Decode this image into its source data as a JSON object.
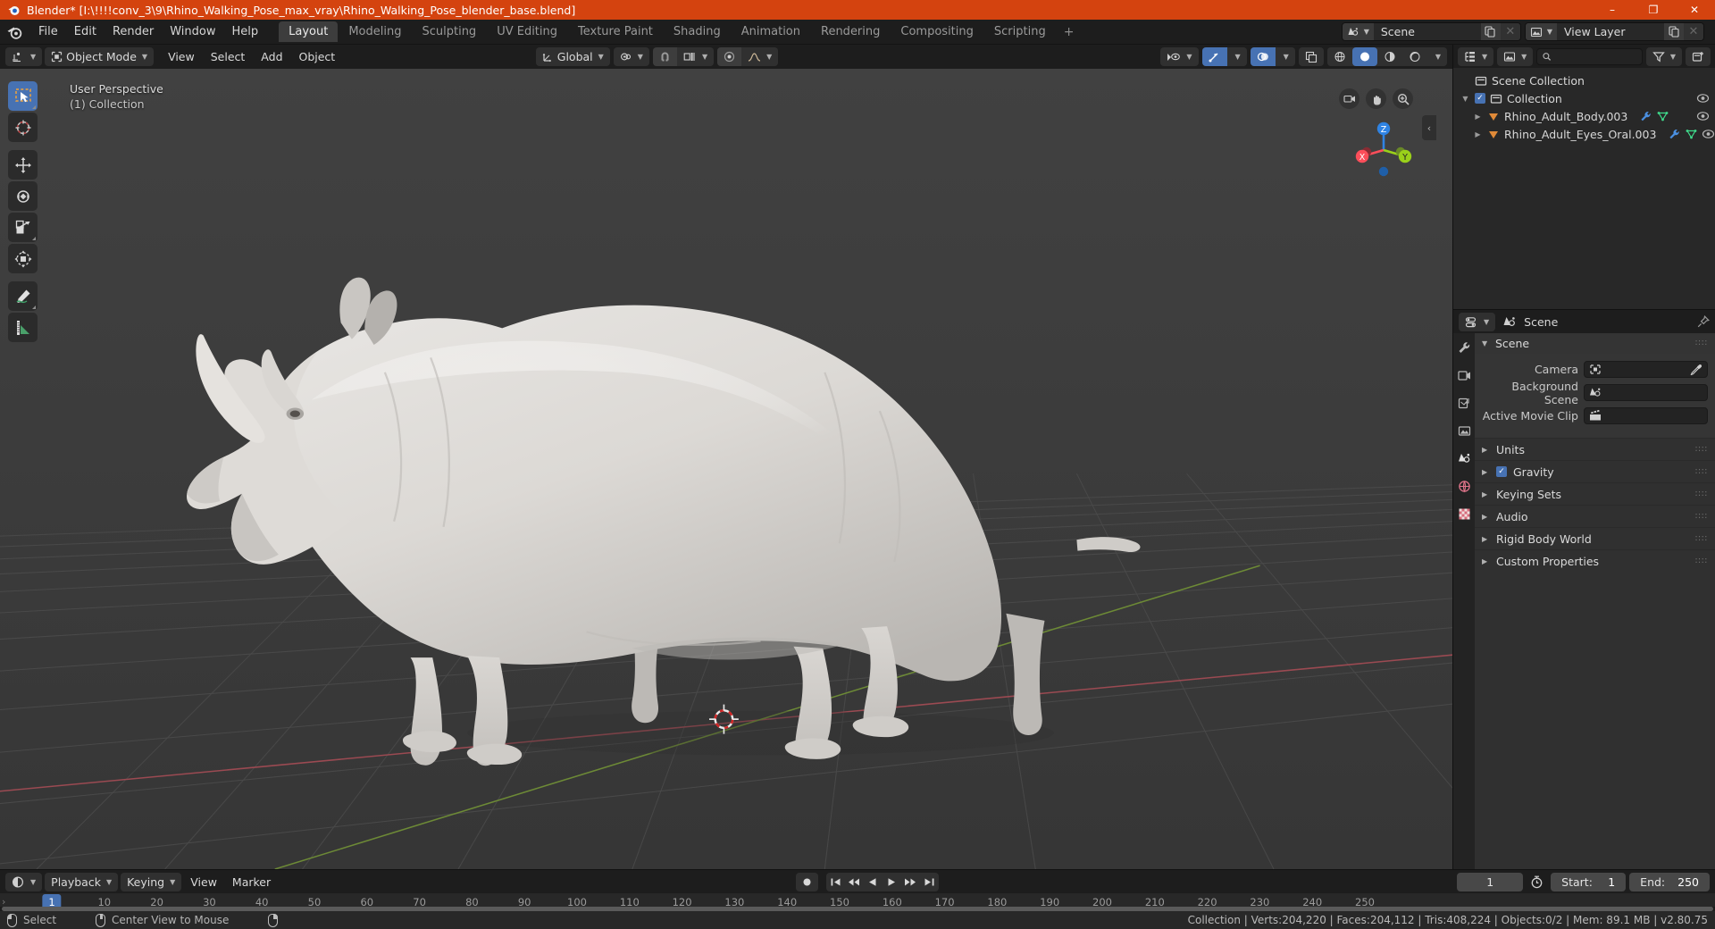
{
  "titlebar": {
    "app_title": "Blender* [I:\\!!!!conv_3\\9\\Rhino_Walking_Pose_max_vray\\Rhino_Walking_Pose_blender_base.blend]",
    "minimize": "–",
    "maximize": "❐",
    "close": "✕"
  },
  "topbar": {
    "menus": [
      "File",
      "Edit",
      "Render",
      "Window",
      "Help"
    ],
    "workspaces": [
      "Layout",
      "Modeling",
      "Sculpting",
      "UV Editing",
      "Texture Paint",
      "Shading",
      "Animation",
      "Rendering",
      "Compositing",
      "Scripting"
    ],
    "active_workspace": "Layout",
    "add_workspace": "+",
    "scene_name": "Scene",
    "view_layer_name": "View Layer"
  },
  "viewport_header": {
    "editor_type": "editor-type-3d-viewport",
    "mode": "Object Mode",
    "menus": [
      "View",
      "Select",
      "Add",
      "Object"
    ],
    "transform_orientation": "Global",
    "snap_label": "snap-magnet",
    "proportional_label": "proportional-editing"
  },
  "viewport": {
    "perspective_label": "User Perspective",
    "collection_label": "(1) Collection",
    "axis_x": "X",
    "axis_y": "Y",
    "axis_z": "Z",
    "tools": [
      "tweak-select-tool",
      "cursor-tool",
      "move-tool",
      "rotate-tool",
      "scale-tool",
      "transform-tool",
      "annotate-tool",
      "measure-tool"
    ],
    "active_tool": "tweak-select-tool"
  },
  "outliner": {
    "display_mode": "View Layer",
    "search_placeholder": "",
    "search_value": "",
    "rows": [
      {
        "label": "Scene Collection",
        "level": 0,
        "type": "scene-collection",
        "has_tri": false,
        "has_check": false,
        "has_eye": false,
        "icons": []
      },
      {
        "label": "Collection",
        "level": 1,
        "type": "collection",
        "has_tri": true,
        "has_check": true,
        "has_eye": true,
        "icons": []
      },
      {
        "label": "Rhino_Adult_Body.003",
        "level": 2,
        "type": "mesh-object",
        "has_tri": true,
        "has_check": false,
        "has_eye": true,
        "icons": [
          "modifier-wrench",
          "mesh-data"
        ]
      },
      {
        "label": "Rhino_Adult_Eyes_Oral.003",
        "level": 2,
        "type": "mesh-object",
        "has_tri": true,
        "has_check": false,
        "has_eye": true,
        "icons": [
          "modifier-wrench",
          "mesh-data"
        ]
      }
    ]
  },
  "properties": {
    "header_title": "Scene",
    "tabs": [
      "tool-tab",
      "render-tab",
      "output-tab",
      "view-layer-tab",
      "scene-tab",
      "world-tab",
      "texture-tab"
    ],
    "active_tab": "scene-tab",
    "panel_title": "Scene",
    "fields": [
      {
        "label": "Camera",
        "value": "",
        "icon": "camera-icon",
        "has_eyedropper": true
      },
      {
        "label": "Background Scene",
        "value": "",
        "icon": "scene-icon",
        "has_eyedropper": false
      },
      {
        "label": "Active Movie Clip",
        "value": "",
        "icon": "movieclip-icon",
        "has_eyedropper": false
      }
    ],
    "sections": [
      {
        "label": "Units",
        "checkbox": null
      },
      {
        "label": "Gravity",
        "checkbox": true
      },
      {
        "label": "Keying Sets",
        "checkbox": null
      },
      {
        "label": "Audio",
        "checkbox": null
      },
      {
        "label": "Rigid Body World",
        "checkbox": null
      },
      {
        "label": "Custom Properties",
        "checkbox": null
      }
    ],
    "grip": "∶∶∶∶"
  },
  "timeline": {
    "editor_type": "timeline-editor",
    "menus": [
      "Playback",
      "Keying",
      "View",
      "Marker"
    ],
    "current_frame": "1",
    "start_label": "Start:",
    "start_value": "1",
    "end_label": "End:",
    "end_value": "250",
    "ticks": [
      "10",
      "20",
      "30",
      "40",
      "50",
      "60",
      "70",
      "80",
      "90",
      "100",
      "110",
      "120",
      "130",
      "140",
      "150",
      "160",
      "170",
      "180",
      "190",
      "200",
      "210",
      "220",
      "230",
      "240",
      "250"
    ],
    "playhead_frame": "1"
  },
  "statusbar": {
    "left_hint": "Select",
    "middle_hint": "Center View to Mouse",
    "stats": "Collection | Verts:204,220 | Faces:204,112 | Tris:408,224 | Objects:0/2 | Mem: 89.1 MB | v2.80.75"
  },
  "colors": {
    "accent": "#4772b3",
    "title_bar": "#d4430f",
    "axis_x": "#fc4e5a",
    "axis_y": "#9ad01a",
    "axis_z": "#2f83e3"
  }
}
